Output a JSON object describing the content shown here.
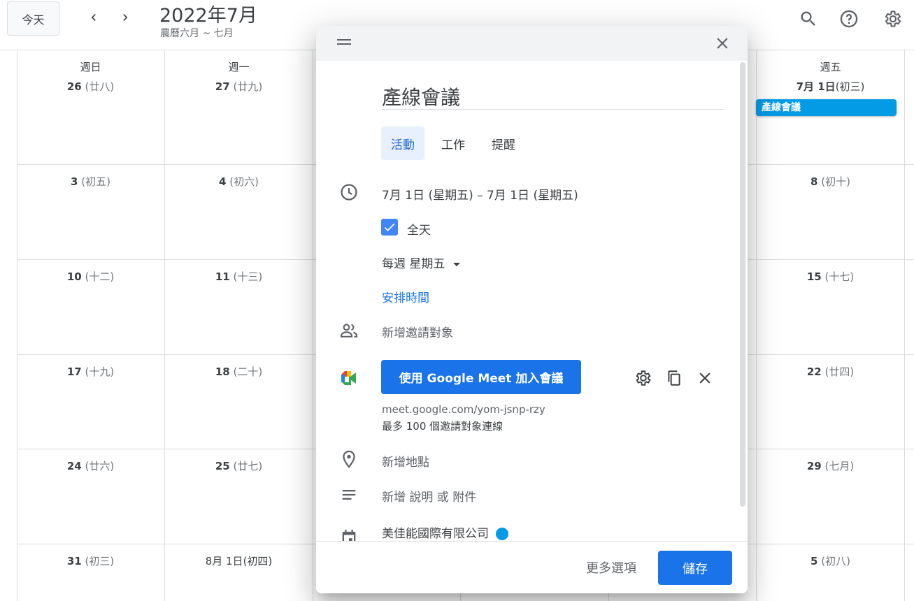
{
  "header": {
    "today_label": "今天",
    "month_title": "2022年7月",
    "lunar_subtitle": "農曆六月 ~ 七月",
    "icons": [
      "chevron-left-icon",
      "chevron-right-icon",
      "search-icon",
      "help-icon",
      "settings-icon"
    ]
  },
  "calendar": {
    "days_of_week": [
      "週日",
      "週一",
      "",
      "",
      "",
      "週五"
    ],
    "week_rows": [
      [
        {
          "d": "26",
          "l": "(廿八)"
        },
        {
          "d": "27",
          "l": "(廿九)"
        },
        {
          "d": "7月 1日",
          "l": "(初三)"
        }
      ],
      [
        {
          "d": "3",
          "l": "(初五)"
        },
        {
          "d": "4",
          "l": "(初六)"
        },
        {
          "d": "8",
          "l": "(初十)"
        }
      ],
      [
        {
          "d": "10",
          "l": "(十二)"
        },
        {
          "d": "11",
          "l": "(十三)"
        },
        {
          "d": "15",
          "l": "(十七)"
        }
      ],
      [
        {
          "d": "17",
          "l": "(十九)"
        },
        {
          "d": "18",
          "l": "(二十)"
        },
        {
          "d": "22",
          "l": "(廿四)"
        }
      ],
      [
        {
          "d": "24",
          "l": "(廿六)"
        },
        {
          "d": "25",
          "l": "(廿七)"
        },
        {
          "d": "29",
          "l": "(七月)"
        }
      ],
      [
        {
          "d": "31",
          "l": "(初三)"
        },
        {
          "d": "8月 1日",
          "l": "(初四)"
        },
        {
          "d": "5",
          "l": "(初八)"
        }
      ]
    ],
    "event_chip": "產線會議",
    "event_color": "#039be5"
  },
  "dialog": {
    "title_value": "產線會議",
    "tabs": [
      "活動",
      "工作",
      "提醒"
    ],
    "active_tab": "活動",
    "date_range": "7月 1日 (星期五)  –  7月 1日 (星期五)",
    "all_day_label": "全天",
    "all_day_checked": true,
    "recurrence": "每週 星期五",
    "schedule_link": "安排時間",
    "add_guests": "新增邀請對象",
    "meet_button": "使用 Google Meet 加入會議",
    "meet_url": "meet.google.com/yom-jsnp-rzy",
    "meet_limit": "最多 100 個邀請對象連線",
    "add_location": "新增地點",
    "add_description": "新增 說明 或 附件",
    "calendar_owner": "美佳能國際有限公司",
    "calendar_color": "#039be5",
    "more_options": "更多選項",
    "save": "儲存"
  }
}
